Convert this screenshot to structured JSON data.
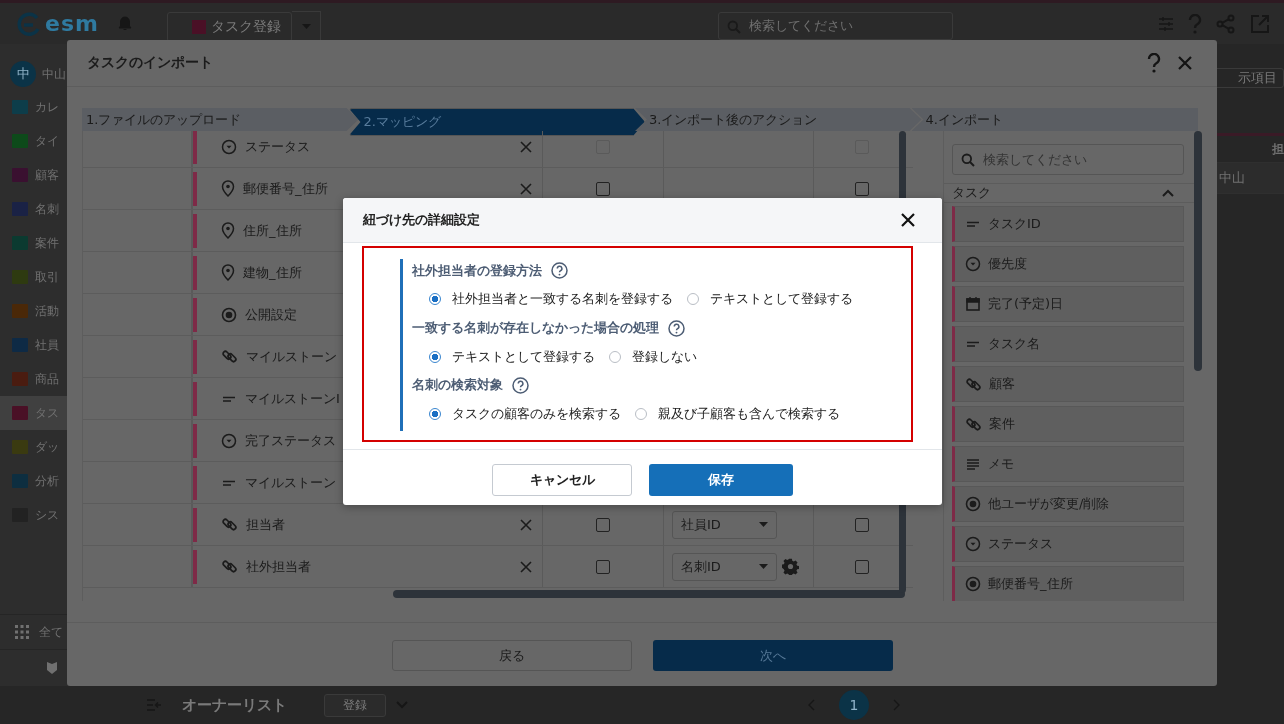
{
  "app": {
    "logo": "esm",
    "header": {
      "task_button": "タスク登録",
      "search": {
        "placeholder": "検索してください"
      }
    },
    "sidebar": {
      "user": {
        "initial": "中",
        "name": "中山"
      },
      "items": [
        {
          "label": "カレ",
          "selected": false
        },
        {
          "label": "タイ",
          "selected": false
        },
        {
          "label": "顧客",
          "selected": false
        },
        {
          "label": "名刺",
          "selected": false
        },
        {
          "label": "案件",
          "selected": false
        },
        {
          "label": "取引",
          "selected": false
        },
        {
          "label": "活動",
          "selected": false
        },
        {
          "label": "社員",
          "selected": false
        },
        {
          "label": "商品",
          "selected": false
        },
        {
          "label": "タス",
          "selected": true
        },
        {
          "label": "ダッ",
          "selected": false
        },
        {
          "label": "分析",
          "selected": false
        },
        {
          "label": "シス",
          "selected": false
        }
      ],
      "all_menu": "全て"
    },
    "right_strip": {
      "display_items_button": "示項目",
      "column_1": "担",
      "cell": "中山"
    },
    "bottom_bar": {
      "list_title": "オーナーリスト",
      "register_button": "登録",
      "pages": [
        {
          "label": "1",
          "selected": true
        }
      ]
    }
  },
  "import_modal": {
    "title": "タスクのインポート",
    "steps": [
      {
        "label": "1.ファイルのアップロード",
        "selected": false
      },
      {
        "label": "2.マッピング",
        "selected": true
      },
      {
        "label": "3.インポート後のアクション",
        "selected": false
      },
      {
        "label": "4.インポート",
        "selected": false
      }
    ],
    "rows": [
      {
        "kind": "select",
        "field": "ステータス",
        "removable": true,
        "checks": [
          {
            "checked": false,
            "disabled": true
          },
          {
            "checked": false,
            "disabled": true
          }
        ]
      },
      {
        "kind": "location",
        "field": "郵便番号_住所",
        "removable": true,
        "checks": [
          {
            "checked": false,
            "disabled": false
          },
          {
            "checked": false,
            "disabled": false
          }
        ]
      },
      {
        "kind": "location",
        "field": "住所_住所"
      },
      {
        "kind": "location",
        "field": "建物_住所"
      },
      {
        "kind": "radio",
        "field": "公開設定"
      },
      {
        "kind": "link",
        "field": "マイルストーン"
      },
      {
        "kind": "text",
        "field": "マイルストーンI"
      },
      {
        "kind": "select",
        "field": "完了ステータス"
      },
      {
        "kind": "text",
        "field": "マイルストーン"
      },
      {
        "kind": "link",
        "field": "担当者",
        "removable": true,
        "checks": [
          {
            "checked": false,
            "disabled": false
          },
          {
            "checked": false,
            "disabled": false
          }
        ],
        "mapping": "社員ID",
        "settings": false
      },
      {
        "kind": "link",
        "field": "社外担当者",
        "removable": true,
        "checks": [
          {
            "checked": false,
            "disabled": false
          },
          {
            "checked": false,
            "disabled": false
          }
        ],
        "mapping": "名刺ID",
        "settings": true
      }
    ],
    "panel": {
      "search": {
        "placeholder": "検索してください"
      },
      "section": "タスク",
      "expanded": true,
      "items": [
        {
          "kind": "text",
          "label": "タスクID"
        },
        {
          "kind": "select",
          "label": "優先度"
        },
        {
          "kind": "date",
          "label": "完了(予定)日"
        },
        {
          "kind": "text",
          "label": "タスク名"
        },
        {
          "kind": "link",
          "label": "顧客"
        },
        {
          "kind": "link",
          "label": "案件"
        },
        {
          "kind": "memo",
          "label": "メモ"
        },
        {
          "kind": "radio",
          "label": "他ユーザが変更/削除"
        },
        {
          "kind": "select",
          "label": "ステータス"
        },
        {
          "kind": "radio",
          "label": "郵便番号_住所"
        }
      ]
    },
    "back_button": "戻る",
    "next_button": "次へ"
  },
  "dialog": {
    "title": "紐づけ先の詳細設定",
    "groups": [
      {
        "heading": "社外担当者の登録方法",
        "options": [
          {
            "label": "社外担当者と一致する名刺を登録する",
            "selected": true
          },
          {
            "label": "テキストとして登録する",
            "selected": false
          }
        ]
      },
      {
        "heading": "一致する名刺が存在しなかった場合の処理",
        "options": [
          {
            "label": "テキストとして登録する",
            "selected": true
          },
          {
            "label": "登録しない",
            "selected": false
          }
        ]
      },
      {
        "heading": "名刺の検索対象",
        "options": [
          {
            "label": "タスクの顧客のみを検索する",
            "selected": true
          },
          {
            "label": "親及び子顧客も含んで検索する",
            "selected": false
          }
        ]
      }
    ],
    "cancel_button": "キャンセル",
    "save_button": "保存"
  }
}
